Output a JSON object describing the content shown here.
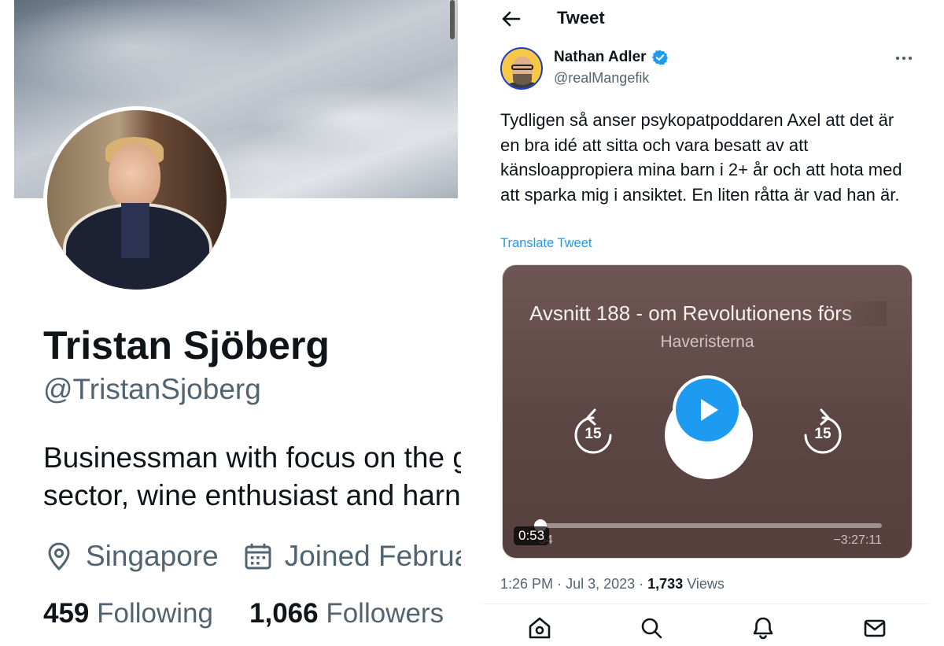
{
  "profile": {
    "name": "Tristan Sjöberg",
    "handle": "@TristanSjoberg",
    "bio_line1": "Businessman with focus on the g",
    "bio_line2": "sector, wine enthusiast and harn",
    "location": "Singapore",
    "joined": "Joined Februa",
    "following_count": "459",
    "following_label": "Following",
    "followers_count": "1,066",
    "followers_label": "Followers",
    "location_icon": "location-pin-icon",
    "calendar_icon": "calendar-icon"
  },
  "tweet_header": {
    "title": "Tweet",
    "back_icon": "back-arrow-icon"
  },
  "tweet": {
    "author_name": "Nathan Adler",
    "author_handle": "@realMangefik",
    "verified_icon": "verified-badge-icon",
    "more_icon": "more-dots-icon",
    "text": "Tydligen så anser psykopatpoddaren Axel att det är en bra idé att sitta och vara besatt av att känsloappropiera mina barn i 2+ år och att hota med att sparka mig i ansiktet. En liten råtta är vad han är.",
    "translate_label": "Translate Tweet",
    "time": "1:26 PM",
    "date": "Jul 3, 2023",
    "views_count": "1,733",
    "views_label": "Views"
  },
  "player": {
    "episode_title": "Avsnitt 188 - om Revolutionens förs",
    "show_name": "Haveristerna",
    "skip_back_seconds": "15",
    "skip_forward_seconds": "15",
    "elapsed": "54",
    "remaining": "−3:27:11",
    "video_timestamp": "0:53",
    "progress_fraction": 0.01
  },
  "bottom_nav": {
    "items": [
      "home-icon",
      "search-icon",
      "notifications-bell-icon",
      "messages-envelope-icon"
    ]
  },
  "colors": {
    "accent": "#1d9bf0",
    "text_primary": "#0f1419",
    "text_secondary": "#536471",
    "player_bg": "#5c4644"
  }
}
